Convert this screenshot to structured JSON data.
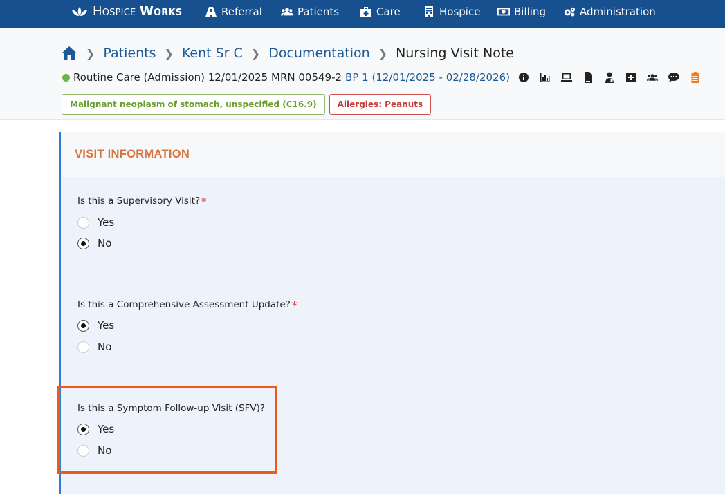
{
  "nav": {
    "brand_light": "Hospice",
    "brand_bold": "Works",
    "items": [
      {
        "label": "Referral",
        "icon": "road-icon"
      },
      {
        "label": "Patients",
        "icon": "users-icon"
      },
      {
        "label": "Care",
        "icon": "medkit-icon"
      },
      {
        "label": "Hospice",
        "icon": "building-icon"
      },
      {
        "label": "Billing",
        "icon": "money-icon"
      },
      {
        "label": "Administration",
        "icon": "cogs-icon"
      }
    ]
  },
  "breadcrumb": {
    "home_icon": "home-icon",
    "items": [
      "Patients",
      "Kent Sr C",
      "Documentation"
    ],
    "current": "Nursing Visit Note"
  },
  "patient": {
    "status_color": "#6cb34a",
    "care_level": "Routine Care",
    "admission": "(Admission)",
    "date": "12/01/2025",
    "mrn": "MRN 00549-2",
    "benefit_period": "BP 1 (12/01/2025 - 02/28/2026)",
    "icons": [
      "info-icon",
      "chart-icon",
      "laptop-icon",
      "document-icon",
      "doctor-icon",
      "plus-square-icon",
      "group-icon",
      "comment-icon",
      "clipboard-icon"
    ]
  },
  "tags": {
    "diagnosis": "Malignant neoplasm of stomach, unspecified (C16.9)",
    "allergies": "Allergies: Peanuts"
  },
  "form": {
    "section_title": "VISIT INFORMATION",
    "questions": [
      {
        "label": "Is this a Supervisory Visit?",
        "required": true,
        "options": [
          "Yes",
          "No"
        ],
        "selected": "No"
      },
      {
        "label": "Is this a Comprehensive Assessment Update?",
        "required": true,
        "options": [
          "Yes",
          "No"
        ],
        "selected": "Yes"
      },
      {
        "label": "Is this a Symptom Follow-up Visit (SFV)?",
        "required": false,
        "options": [
          "Yes",
          "No"
        ],
        "selected": "Yes"
      }
    ],
    "required_mark": "*"
  },
  "colors": {
    "nav_bg": "#17508f",
    "link": "#1b5a96",
    "section_title": "#d9733f",
    "highlight": "#f05a14"
  }
}
